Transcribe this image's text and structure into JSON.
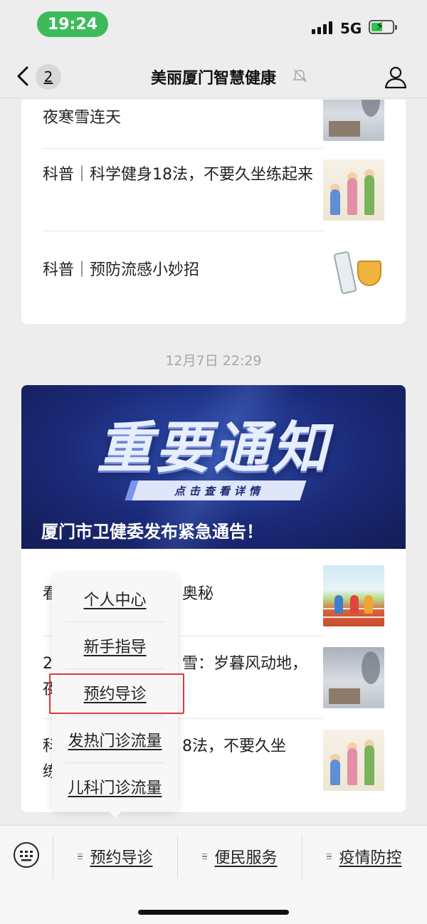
{
  "status_bar": {
    "time": "19:24",
    "network": "5G",
    "battery_charging": true
  },
  "nav": {
    "back_badge": "2",
    "title": "美丽厦门智慧健康"
  },
  "feed_top": {
    "articles": [
      {
        "title_partial": "夜寒雪连天",
        "thumb": "snowy-scene"
      },
      {
        "title": "科普｜科学健身18法，不要久坐练起来",
        "thumb": "family-fitness"
      },
      {
        "title": "科普｜预防流感小妙招",
        "thumb": "flu-vaccine"
      }
    ]
  },
  "timestamp": "12月7日 22:29",
  "feed_main": {
    "banner": {
      "title": "重要通知",
      "pill": "点击查看详情",
      "caption": "厦门市卫健委发布紧急通告！"
    },
    "articles": [
      {
        "title_visible_prefix": "看",
        "title_visible_suffix": "奥秘",
        "thumb": "running-track"
      },
      {
        "title_visible_prefix": "2",
        "title_visible_suffix": "雪：岁暮风动地，",
        "line2_prefix": "夜",
        "thumb": "snowy-scene"
      },
      {
        "title_visible_prefix": "科",
        "title_visible_suffix": "8法，不要久坐",
        "line2_prefix": "练",
        "thumb": "family-fitness"
      }
    ]
  },
  "popup_menu": {
    "items": [
      "个人中心",
      "新手指导",
      "预约导诊",
      "发热门诊流量",
      "儿科门诊流量"
    ],
    "highlighted_index": 2
  },
  "bottom_menu": {
    "buttons": [
      "预约导诊",
      "便民服务",
      "疫情防控"
    ]
  },
  "colors": {
    "accent_green": "#3dbb5a",
    "highlight_red": "#e0393e",
    "banner_blue": "#1b2a78"
  }
}
